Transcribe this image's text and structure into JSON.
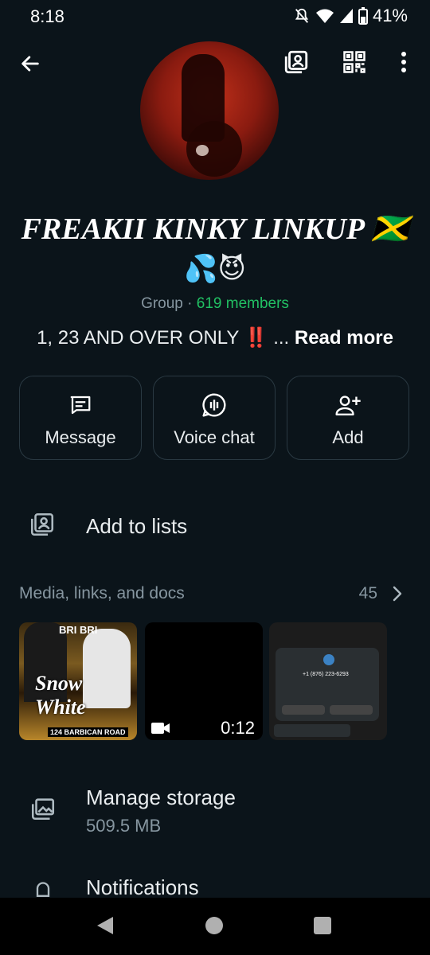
{
  "status": {
    "time": "8:18",
    "battery": "41%"
  },
  "header": {
    "back_icon": "arrow-left-icon",
    "list_icon": "contact-list-icon",
    "qr_icon": "qr-code-icon",
    "more_icon": "more-vert-icon"
  },
  "group": {
    "name": "FREAKII KINKY LINKUP 🇯🇲",
    "name_emoji": "💦😈",
    "type": "Group",
    "separator": "·",
    "members": "619 members",
    "description": "1, 23 AND OVER ONLY",
    "description_emoji": "‼️",
    "ellipsis": "...",
    "read_more": "Read more"
  },
  "actions": [
    {
      "label": "Message",
      "icon": "message-icon"
    },
    {
      "label": "Voice chat",
      "icon": "voice-chat-icon"
    },
    {
      "label": "Add",
      "icon": "add-person-icon"
    }
  ],
  "lists": {
    "label": "Add to lists"
  },
  "media": {
    "title": "Media, links, and docs",
    "count": "45",
    "thumbs": [
      {
        "title_text": "Snow White",
        "top_text": "BRI BRI",
        "address": "124 BARBICAN ROAD"
      },
      {
        "duration": "0:12"
      },
      {
        "phone": "+1 (876) 223-6293"
      }
    ]
  },
  "storage": {
    "label": "Manage storage",
    "size": "509.5 MB"
  },
  "notifications": {
    "label": "Notifications"
  },
  "colors": {
    "accent_green": "#21c063",
    "background": "#0b141a",
    "muted": "#8696a0"
  }
}
